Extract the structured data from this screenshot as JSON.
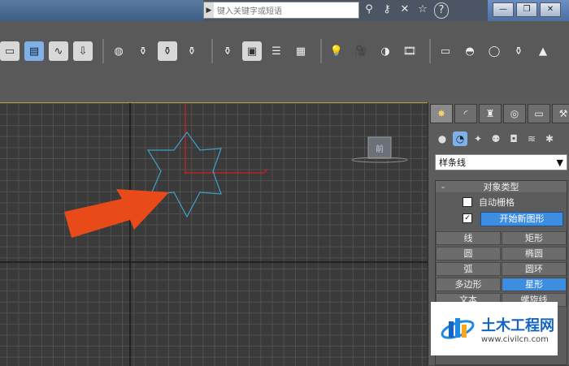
{
  "titlebar": {
    "search_placeholder": "键入关键字或短语"
  },
  "command_panel": {
    "category_dropdown": "样条线",
    "rollout": {
      "collapse_symbol": "-",
      "title": "对象类型",
      "auto_grid_label": "自动栅格",
      "start_new_shape_checked": "✓",
      "start_new_shape_label": "开始新图形",
      "buttons": [
        {
          "label": "线"
        },
        {
          "label": "矩形"
        },
        {
          "label": "圆"
        },
        {
          "label": "椭圆"
        },
        {
          "label": "弧"
        },
        {
          "label": "圆环"
        },
        {
          "label": "多边形"
        },
        {
          "label": "星形",
          "active": true
        },
        {
          "label": "文本"
        },
        {
          "label": "螺旋线"
        }
      ]
    }
  },
  "viewport": {
    "cube_label": "前"
  },
  "watermark": {
    "title": "土木工程网",
    "url": "www.civilcn.com"
  },
  "colors": {
    "accent": "#3d8de0",
    "arrow": "#e84a1a",
    "star": "#3fa0c8",
    "axis": "#d02020"
  }
}
